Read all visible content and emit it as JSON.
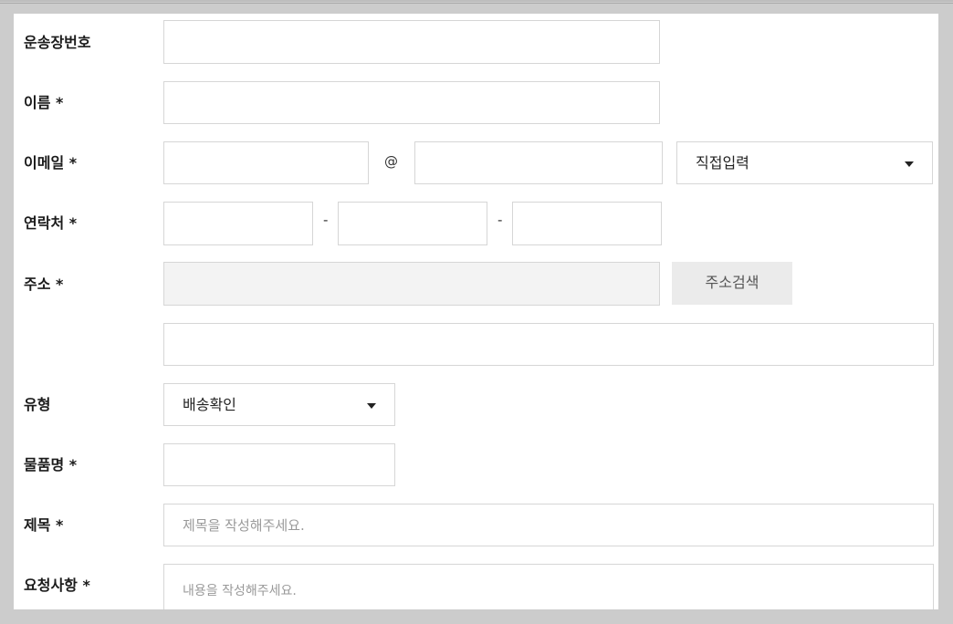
{
  "form": {
    "tracking": {
      "label": "운송장번호"
    },
    "name": {
      "label": "이름 *"
    },
    "email": {
      "label": "이메일 *",
      "at": "@",
      "domain_select": "직접입력"
    },
    "phone": {
      "label": "연락처 *",
      "dash1": "-",
      "dash2": "-"
    },
    "address": {
      "label": "주소 *",
      "search_button": "주소검색"
    },
    "type": {
      "label": "유형",
      "select": "배송확인"
    },
    "product": {
      "label": "물품명 *"
    },
    "subject": {
      "label": "제목 *",
      "placeholder": "제목을 작성해주세요."
    },
    "request": {
      "label": "요청사항 *",
      "placeholder": "내용을 작성해주세요."
    }
  }
}
